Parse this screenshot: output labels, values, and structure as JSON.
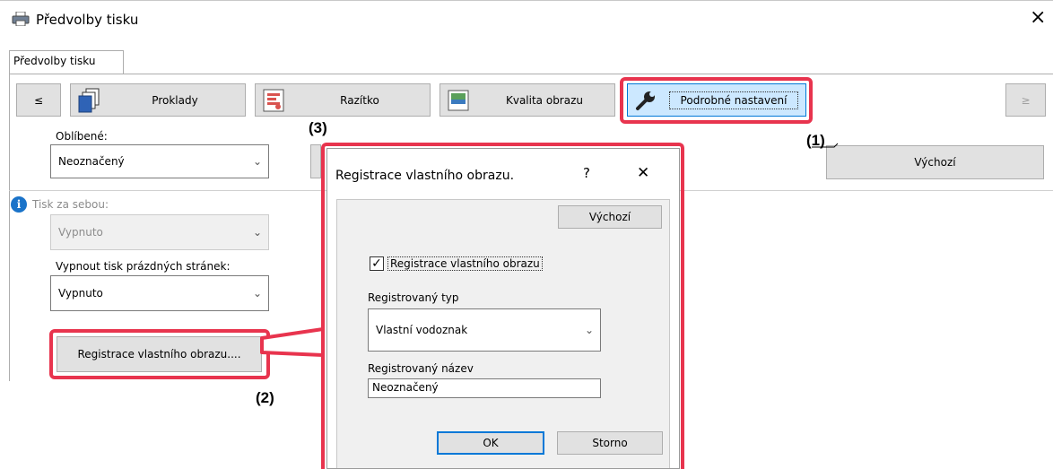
{
  "window": {
    "title": "Předvolby tisku",
    "close_glyph": "×"
  },
  "tab": {
    "label": "Předvolby tisku"
  },
  "nav": {
    "prev": "≤",
    "next": "≥",
    "buttons": [
      {
        "label": "Proklady",
        "icon": "documents-icon"
      },
      {
        "label": "Razítko",
        "icon": "stamp-icon"
      },
      {
        "label": "Kvalita obrazu",
        "icon": "image-quality-icon"
      },
      {
        "label": "Podrobné nastavení",
        "icon": "wrench-icon"
      }
    ]
  },
  "favorites": {
    "label": "Oblíbené:",
    "value": "Neoznačený"
  },
  "default_button": "Výchozí",
  "tandem": {
    "label": "Tisk za sebou:",
    "value": "Vypnuto"
  },
  "blank_pages": {
    "label": "Vypnout tisk prázdných stránek:",
    "value": "Vypnuto"
  },
  "register_button": "Registrace vlastního obrazu....",
  "callouts": {
    "c1": "(1)",
    "c2": "(2)",
    "c3": "(3)"
  },
  "dialog": {
    "title": "Registrace vlastního obrazu.",
    "help": "?",
    "close": "✕",
    "default_button": "Výchozí",
    "checkbox_label": "Registrace vlastního obrazu",
    "checkbox_checked": true,
    "type_label": "Registrovaný typ",
    "type_value": "Vlastní vodoznak",
    "name_label": "Registrovaný název",
    "name_value": "Neoznačený",
    "ok": "OK",
    "cancel": "Storno"
  },
  "colors": {
    "highlight": "#e8344e",
    "selected_tab": "#cce8ff",
    "button_face": "#e1e1e1"
  }
}
